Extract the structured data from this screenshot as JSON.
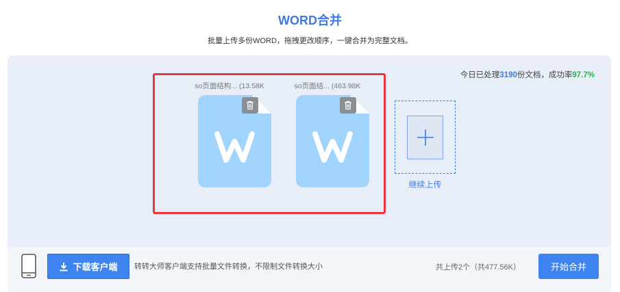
{
  "header": {
    "title": "WORD合并",
    "subtitle": "批量上传多份WORD，拖拽更改顺序，一键合并为完整文档。"
  },
  "stats": {
    "prefix": "今日已处理",
    "count": "3190",
    "middle": "份文档，成功率",
    "rate": "97.7%"
  },
  "files": [
    {
      "name": "so页面结构...",
      "size": "(13.58K",
      "icon": "word-doc-icon"
    },
    {
      "name": "so页面结...",
      "size": "(463.98K",
      "icon": "word-doc-icon"
    }
  ],
  "upload": {
    "label": "继续上传",
    "icon": "plus-icon"
  },
  "footer": {
    "download_label": "下载客户端",
    "download_tip": "转转大师客户端支持批量文件转换，不限制文件转换大小",
    "count_text": "共上传2个（共477.56K）",
    "start_label": "开始合并"
  },
  "colors": {
    "accent": "#3d7ae8",
    "success": "#2bb24c",
    "doc": "#a0d4fc",
    "highlight": "#e8363b"
  }
}
